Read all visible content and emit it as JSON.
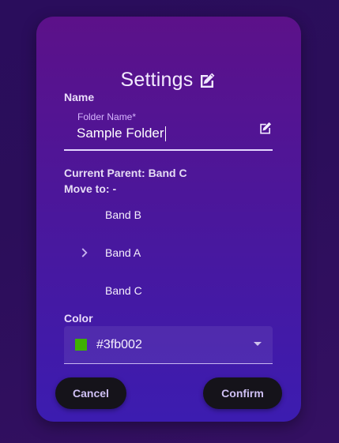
{
  "dialog": {
    "title": "Settings",
    "title_icon": "edit-square-icon"
  },
  "name_section": {
    "label": "Name",
    "field_label": "Folder Name*",
    "field_value": "Sample Folder",
    "field_icon": "edit-square-icon"
  },
  "parent_info": {
    "current_parent": "Current Parent: Band C",
    "move_to": "Move to: -"
  },
  "tree": {
    "items": [
      {
        "label": "Band B",
        "expandable": false
      },
      {
        "label": "Band A",
        "expandable": true,
        "icon": "chevron-right-icon"
      },
      {
        "label": "Band C",
        "expandable": false
      }
    ]
  },
  "color_section": {
    "label": "Color",
    "selected_value": "#3fb002",
    "swatch_color": "#3fb002",
    "dropdown_icon": "dropdown-arrow-icon"
  },
  "actions": {
    "cancel_label": "Cancel",
    "confirm_label": "Confirm"
  },
  "theme": {
    "card_top": "#5c1189",
    "card_bottom": "#3c1cb0",
    "button_bg": "#15131a",
    "accent_label": "#d7b6ff"
  }
}
